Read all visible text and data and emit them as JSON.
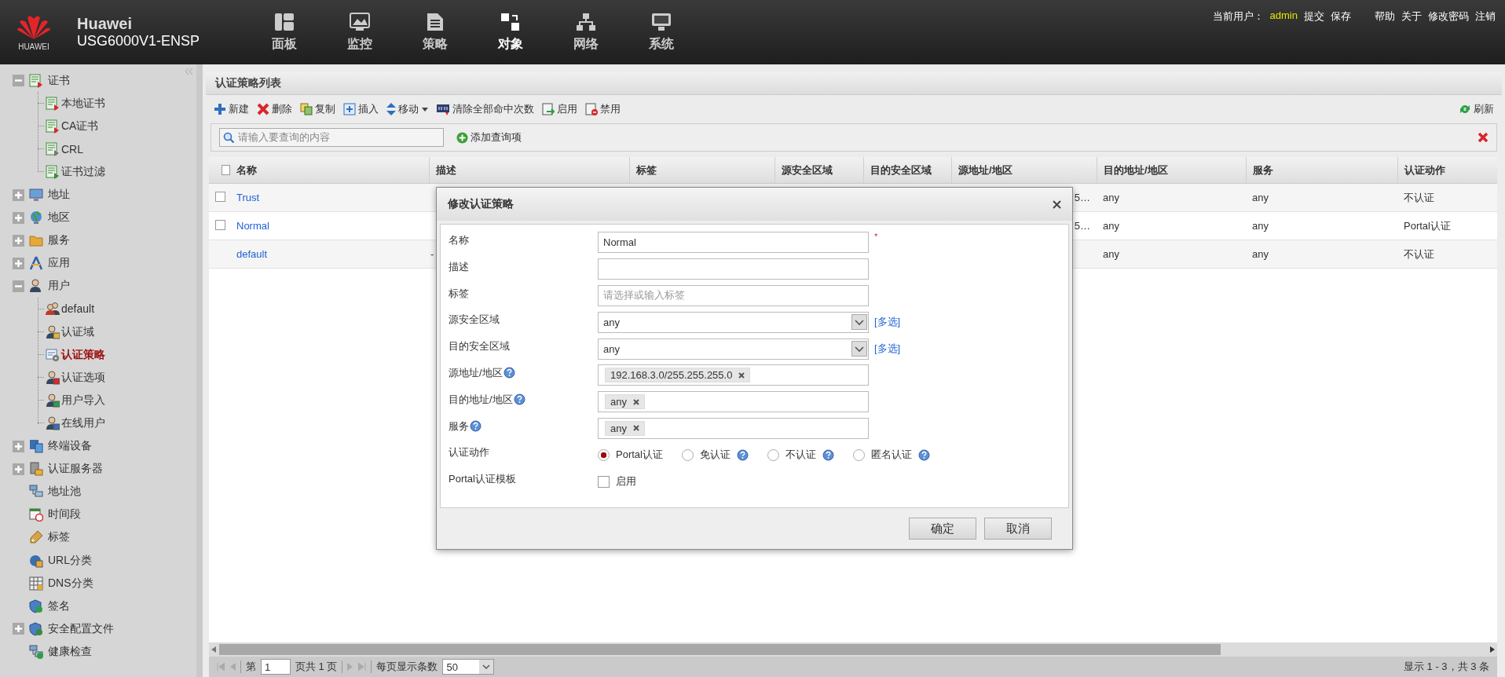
{
  "header": {
    "logo_text": "HUAWEI",
    "brand": "Huawei",
    "model": "USG6000V1-ENSP",
    "nav": [
      {
        "label": "面板",
        "selected": false
      },
      {
        "label": "监控",
        "selected": false
      },
      {
        "label": "策略",
        "selected": false
      },
      {
        "label": "对象",
        "selected": true
      },
      {
        "label": "网络",
        "selected": false
      },
      {
        "label": "系统",
        "selected": false
      }
    ],
    "user_label": "当前用户：",
    "user": "admin",
    "actions": [
      "提交",
      "保存",
      "帮助",
      "关于",
      "修改密码",
      "注销"
    ]
  },
  "sidebar": {
    "items": [
      {
        "label": "证书",
        "kind": "group",
        "expanded": true,
        "selected": false,
        "children": [
          {
            "label": "本地证书",
            "selected": false
          },
          {
            "label": "CA证书",
            "selected": false
          },
          {
            "label": "CRL",
            "selected": false
          },
          {
            "label": "证书过滤",
            "selected": false
          }
        ]
      },
      {
        "label": "地址",
        "kind": "group",
        "expanded": false,
        "selected": false
      },
      {
        "label": "地区",
        "kind": "group",
        "expanded": false,
        "selected": false
      },
      {
        "label": "服务",
        "kind": "group",
        "expanded": false,
        "selected": false
      },
      {
        "label": "应用",
        "kind": "group",
        "expanded": false,
        "selected": false
      },
      {
        "label": "用户",
        "kind": "group",
        "expanded": true,
        "selected": false,
        "children": [
          {
            "label": "default",
            "selected": false
          },
          {
            "label": "认证域",
            "selected": false
          },
          {
            "label": "认证策略",
            "selected": true
          },
          {
            "label": "认证选项",
            "selected": false
          },
          {
            "label": "用户导入",
            "selected": false
          },
          {
            "label": "在线用户",
            "selected": false
          }
        ]
      },
      {
        "label": "终端设备",
        "kind": "group",
        "expanded": false,
        "selected": false
      },
      {
        "label": "认证服务器",
        "kind": "group",
        "expanded": false,
        "selected": false
      },
      {
        "label": "地址池",
        "kind": "leaf",
        "selected": false
      },
      {
        "label": "时间段",
        "kind": "leaf",
        "selected": false
      },
      {
        "label": "标签",
        "kind": "leaf",
        "selected": false
      },
      {
        "label": "URL分类",
        "kind": "leaf",
        "selected": false
      },
      {
        "label": "DNS分类",
        "kind": "leaf",
        "selected": false
      },
      {
        "label": "签名",
        "kind": "leaf",
        "selected": false
      },
      {
        "label": "安全配置文件",
        "kind": "group",
        "expanded": false,
        "selected": false
      },
      {
        "label": "健康检查",
        "kind": "leaf",
        "selected": false
      }
    ]
  },
  "panel": {
    "title": "认证策略列表",
    "toolbar": [
      {
        "label": "新建",
        "dropdown": false
      },
      {
        "label": "删除",
        "dropdown": false
      },
      {
        "label": "复制",
        "dropdown": false
      },
      {
        "label": "插入",
        "dropdown": false
      },
      {
        "label": "移动",
        "dropdown": true
      },
      {
        "label": "清除全部命中次数",
        "dropdown": false
      },
      {
        "label": "启用",
        "dropdown": false
      },
      {
        "label": "禁用",
        "dropdown": false
      }
    ],
    "refresh": "刷新",
    "search": {
      "placeholder": "请输入要查询的内容"
    },
    "add_query": "添加查询项",
    "table": {
      "select_all_checked": false,
      "columns": [
        "名称",
        "描述",
        "标签",
        "源安全区域",
        "目的安全区域",
        "源地址/地区",
        "目的地址/地区",
        "服务",
        "认证动作"
      ],
      "rows": [
        {
          "checkbox": true,
          "checked": false,
          "name": "Trust",
          "source_address": "5…",
          "destination_address": "any",
          "service": "any",
          "action": "不认证"
        },
        {
          "checkbox": true,
          "checked": false,
          "name": "Normal",
          "source_address": "5…",
          "destination_address": "any",
          "service": "any",
          "action": "Portal认证"
        },
        {
          "checkbox": false,
          "name": "default",
          "description": "-",
          "destination_address": "any",
          "service": "any",
          "action": "不认证"
        }
      ]
    },
    "pager": {
      "page_prefix": "第",
      "page": "1",
      "page_suffix": "页共 1 页",
      "per_page_label": "每页显示条数",
      "per_page": "50",
      "summary": "显示 1 - 3，共 3 条"
    }
  },
  "dialog": {
    "title": "修改认证策略",
    "fields": [
      {
        "kind": "text",
        "label": "名称",
        "value": "Normal",
        "required_mark": "*",
        "help": false
      },
      {
        "kind": "text",
        "label": "描述",
        "help": false
      },
      {
        "kind": "text",
        "label": "标签",
        "placeholder": "请选择或输入标签",
        "help": false
      },
      {
        "kind": "select",
        "label": "源安全区域",
        "value": "any",
        "link": "[多选]",
        "help": false
      },
      {
        "kind": "select",
        "label": "目的安全区域",
        "value": "any",
        "link": "[多选]",
        "help": false
      },
      {
        "kind": "tags",
        "label": "源地址/地区",
        "tags": [
          "192.168.3.0/255.255.255.0"
        ],
        "help": true
      },
      {
        "kind": "tags",
        "label": "目的地址/地区",
        "tags": [
          "any"
        ],
        "help": true
      },
      {
        "kind": "tags",
        "label": "服务",
        "tags": [
          "any"
        ],
        "help": true
      },
      {
        "kind": "radio",
        "label": "认证动作",
        "help": false,
        "options": [
          {
            "label": "Portal认证",
            "selected": true,
            "help": false
          },
          {
            "label": "免认证",
            "selected": false,
            "help": true
          },
          {
            "label": "不认证",
            "selected": false,
            "help": true
          },
          {
            "label": "匿名认证",
            "selected": false,
            "help": true
          }
        ]
      },
      {
        "kind": "checkbox",
        "label": "Portal认证模板",
        "text": "启用",
        "checked": false,
        "help": false
      }
    ],
    "buttons": [
      "确定",
      "取消"
    ]
  }
}
